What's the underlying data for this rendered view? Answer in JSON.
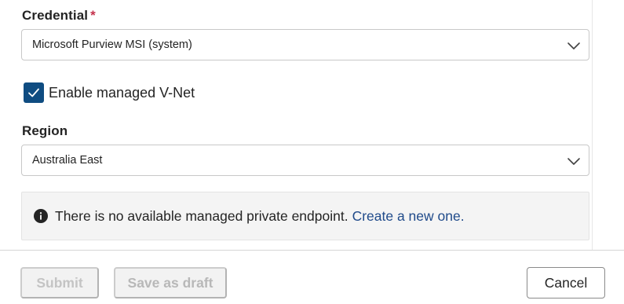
{
  "credential": {
    "label": "Credential",
    "required_mark": "*",
    "value": "Microsoft Purview MSI (system)"
  },
  "managed_vnet": {
    "label": "Enable managed V-Net",
    "checked": true
  },
  "region": {
    "label": "Region",
    "value": "Australia East"
  },
  "info_bar": {
    "message": "There is no available managed private endpoint.",
    "link_text": "Create a new one."
  },
  "footer": {
    "submit_label": "Submit",
    "save_draft_label": "Save as draft",
    "cancel_label": "Cancel"
  },
  "colors": {
    "accent": "#0f4c81",
    "link": "#1f4a8a",
    "required": "#c4314b"
  },
  "icons": {
    "dropdown": "chevron-down-icon",
    "checkbox": "checkmark-icon",
    "info": "info-icon"
  }
}
